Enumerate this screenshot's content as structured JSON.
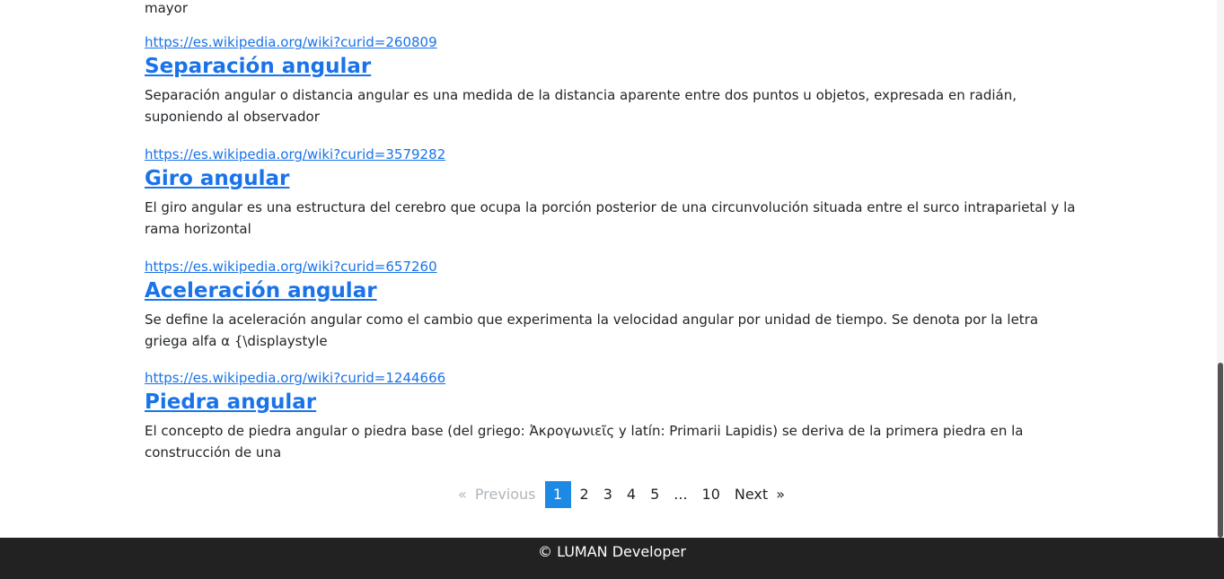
{
  "top_fragment": "mayor",
  "results": [
    {
      "url": "https://es.wikipedia.org/wiki?curid=260809",
      "title": "Separación angular",
      "snippet": "Separación angular o distancia angular es una medida de la distancia aparente entre dos puntos u objetos, expresada en radián, suponiendo al observador"
    },
    {
      "url": "https://es.wikipedia.org/wiki?curid=3579282",
      "title": "Giro angular",
      "snippet": "El giro angular es una estructura del cerebro que ocupa la porción posterior de una circunvolución situada entre el surco intraparietal y la rama horizontal"
    },
    {
      "url": "https://es.wikipedia.org/wiki?curid=657260",
      "title": "Aceleración angular",
      "snippet": "Se define la aceleración angular como el cambio que experimenta la velocidad angular por unidad de tiempo. Se denota por la letra griega alfa α {\\displaystyle"
    },
    {
      "url": "https://es.wikipedia.org/wiki?curid=1244666",
      "title": "Piedra angular",
      "snippet": "El concepto de piedra angular o piedra base (del griego: Ἀκρογωνιεῖς y latín: Primarii Lapidis) se deriva de la primera piedra en la construcción de una"
    }
  ],
  "pagination": {
    "prev_arrow": "«",
    "prev_label": "Previous",
    "pages": [
      "1",
      "2",
      "3",
      "4",
      "5",
      "...",
      "10"
    ],
    "current_page": "1",
    "next_label": "Next",
    "next_arrow": "»"
  },
  "footer": {
    "text": "© LUMAN Developer"
  }
}
